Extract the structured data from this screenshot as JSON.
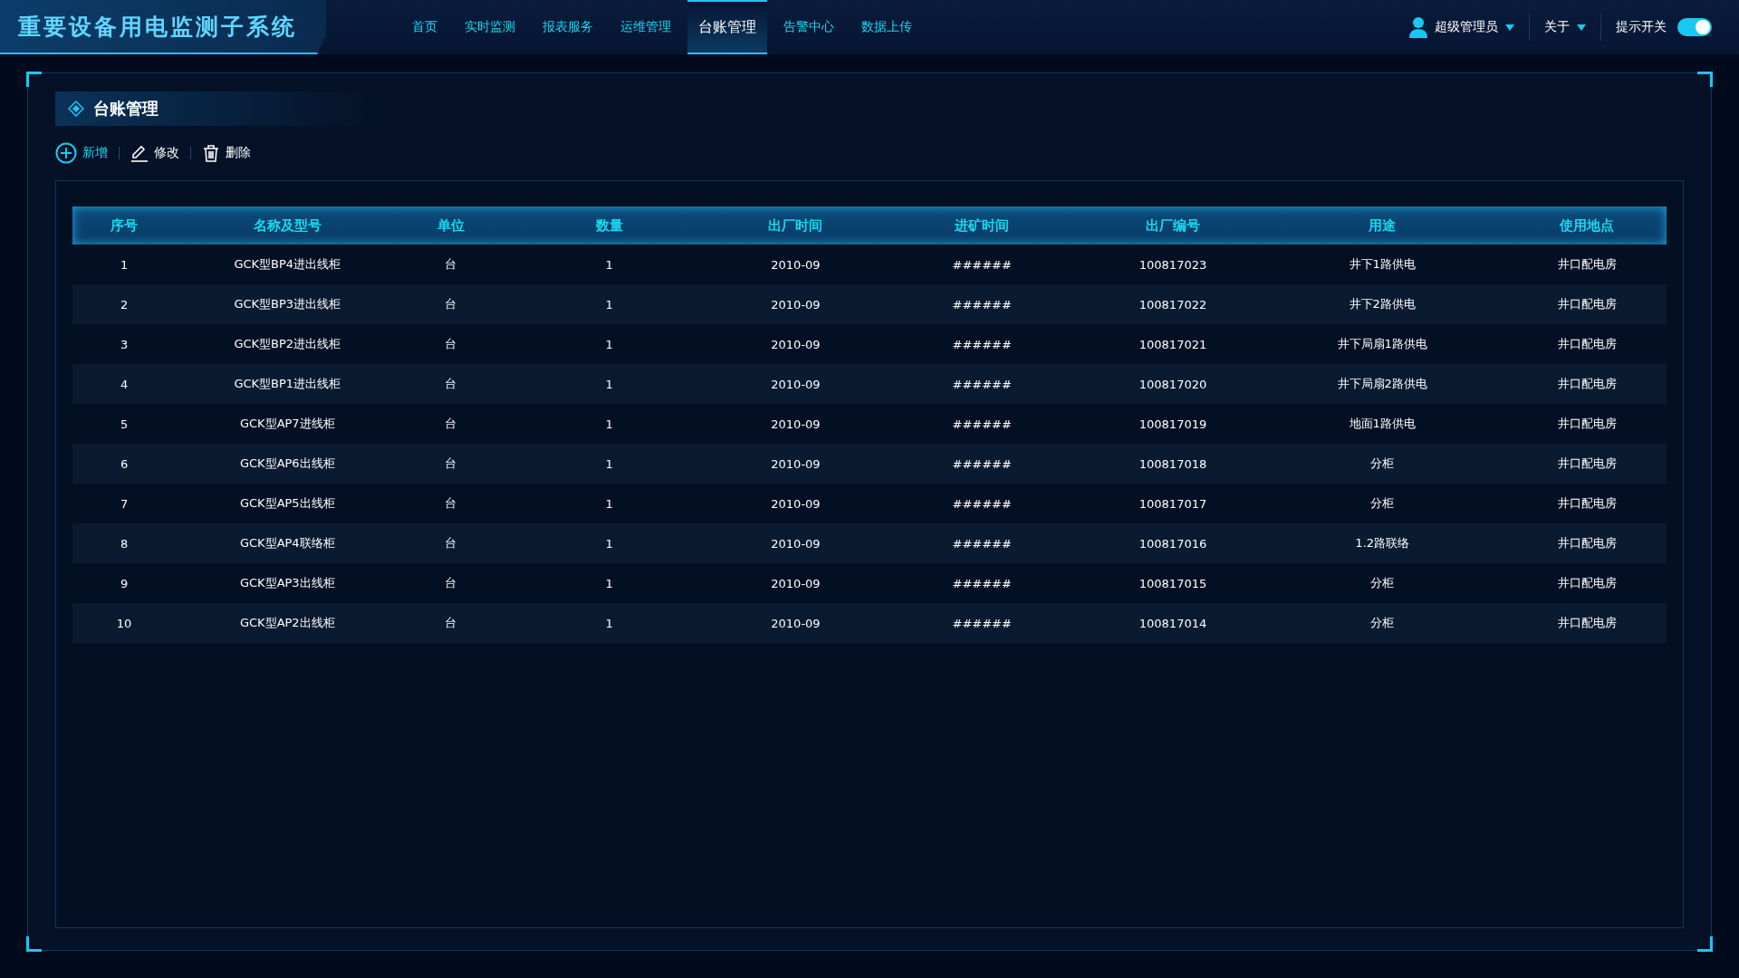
{
  "header": {
    "title": "重要设备用电监测子系统",
    "nav": [
      {
        "label": "首页",
        "selected": false
      },
      {
        "label": "实时监测",
        "selected": false
      },
      {
        "label": "报表服务",
        "selected": false
      },
      {
        "label": "运维管理",
        "selected": false
      },
      {
        "label": "台账管理",
        "selected": true
      },
      {
        "label": "告警中心",
        "selected": false
      },
      {
        "label": "数据上传",
        "selected": false
      }
    ],
    "user": "超级管理员",
    "about": "关于",
    "toggle": {
      "label": "提示开关",
      "on": true
    }
  },
  "panel": {
    "title": "台账管理",
    "toolbar": [
      {
        "kind": "add",
        "label": "新增"
      },
      {
        "kind": "edit",
        "label": "修改"
      },
      {
        "kind": "delete",
        "label": "删除"
      }
    ],
    "table": {
      "columns": [
        "序号",
        "名称及型号",
        "单位",
        "数量",
        "出厂时间",
        "进矿时间",
        "出厂编号",
        "用途",
        "使用地点"
      ],
      "rows": [
        [
          "1",
          "GCK型BP4进出线柜",
          "台",
          "1",
          "2010-09",
          "######",
          "100817023",
          "井下1路供电",
          "井口配电房"
        ],
        [
          "2",
          "GCK型BP3进出线柜",
          "台",
          "1",
          "2010-09",
          "######",
          "100817022",
          "井下2路供电",
          "井口配电房"
        ],
        [
          "3",
          "GCK型BP2进出线柜",
          "台",
          "1",
          "2010-09",
          "######",
          "100817021",
          "井下局扇1路供电",
          "井口配电房"
        ],
        [
          "4",
          "GCK型BP1进出线柜",
          "台",
          "1",
          "2010-09",
          "######",
          "100817020",
          "井下局扇2路供电",
          "井口配电房"
        ],
        [
          "5",
          "GCK型AP7进线柜",
          "台",
          "1",
          "2010-09",
          "######",
          "100817019",
          "地面1路供电",
          "井口配电房"
        ],
        [
          "6",
          "GCK型AP6出线柜",
          "台",
          "1",
          "2010-09",
          "######",
          "100817018",
          "分柜",
          "井口配电房"
        ],
        [
          "7",
          "GCK型AP5出线柜",
          "台",
          "1",
          "2010-09",
          "######",
          "100817017",
          "分柜",
          "井口配电房"
        ],
        [
          "8",
          "GCK型AP4联络柜",
          "台",
          "1",
          "2010-09",
          "######",
          "100817016",
          "1.2路联络",
          "井口配电房"
        ],
        [
          "9",
          "GCK型AP3出线柜",
          "台",
          "1",
          "2010-09",
          "######",
          "100817015",
          "分柜",
          "井口配电房"
        ],
        [
          "10",
          "GCK型AP2出线柜",
          "台",
          "1",
          "2010-09",
          "######",
          "100817014",
          "分柜",
          "井口配电房"
        ]
      ]
    }
  }
}
